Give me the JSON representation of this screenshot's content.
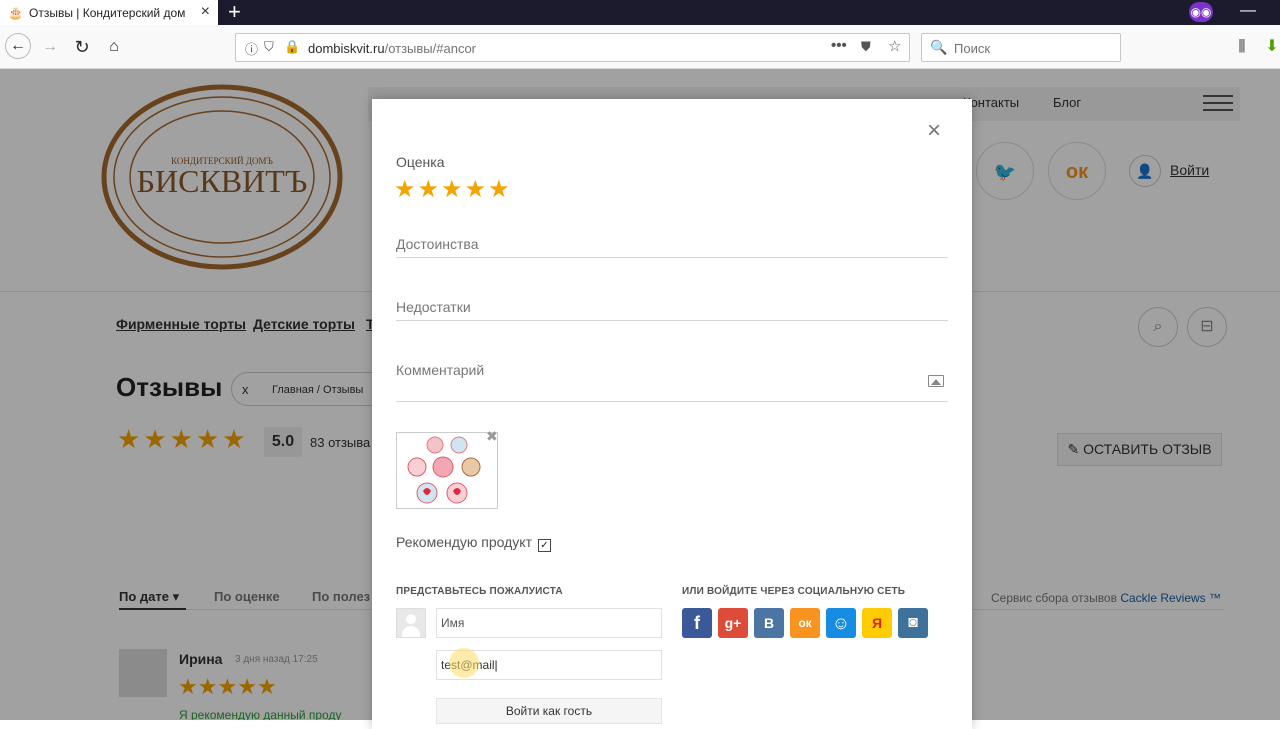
{
  "browser": {
    "tab_title": "Отзывы | Кондитерский дом",
    "new_tab": "+",
    "url_domain": "dombiskvit.ru",
    "url_path": "/отзывы/#ancor",
    "search_placeholder": "Поиск"
  },
  "page": {
    "logo_top_text": "КОНДИТЕРСКИЙ ДОМЪ",
    "logo_brand": "БИСКВИТЪ",
    "topnav": [
      "Контакты",
      "Блог"
    ],
    "login": "Войти",
    "categories": [
      "Фирменные торты",
      "Детские торты",
      "Т"
    ],
    "title": "Отзывы",
    "breadcrumb_close": "x",
    "breadcrumb": "Главная  /  Отзывы",
    "rating_value": "5.0",
    "reviews_count": "83 отзыва",
    "leave_review": "✎ ОСТАВИТЬ ОТЗЫВ",
    "sort_tabs": [
      "По дате ▾",
      "По оценке",
      "По полез"
    ],
    "cackle_prefix": "Сервис сбора отзывов ",
    "cackle_link": "Cackle Reviews ™",
    "reviewer": {
      "name": "Ирина",
      "date": "3 дня назад 17:25",
      "text": "Я рекомендую данный проду"
    }
  },
  "modal": {
    "close": "×",
    "rating_label": "Оценка",
    "rating_stars": 5,
    "field_pros": "Достоинства",
    "field_cons": "Недостатки",
    "field_comment": "Комментарий",
    "thumb_remove": "✖",
    "recommend_label": "Рекомендую продукт",
    "recommend_checked": true,
    "guest_heading": "ПРЕДСТАВЬТЕСЬ ПОЖАЛУИСТА",
    "social_heading": "ИЛИ ВОЙДИТЕ ЧЕРЕЗ СОЦИАЛЬНУЮ СЕТЬ",
    "name_placeholder": "Имя",
    "email_value": "test@mail",
    "guest_button": "Войти как гость",
    "social": [
      {
        "name": "facebook",
        "glyph": "f",
        "color": "#3b5998"
      },
      {
        "name": "google-plus",
        "glyph": "g+",
        "color": "#dd4b39"
      },
      {
        "name": "vkontakte",
        "glyph": "В",
        "color": "#4c75a3"
      },
      {
        "name": "odnoklassniki",
        "glyph": "ок",
        "color": "#f7931e"
      },
      {
        "name": "mail-ru",
        "glyph": "☺",
        "color": "#168de2"
      },
      {
        "name": "yandex",
        "glyph": "Я",
        "color": "#ffcc00"
      },
      {
        "name": "instagram",
        "glyph": "◙",
        "color": "#3f729b"
      }
    ]
  },
  "colors": {
    "star": "#f5a300",
    "accent_link": "#1a5fa0",
    "green_text": "#2a9d3a"
  }
}
